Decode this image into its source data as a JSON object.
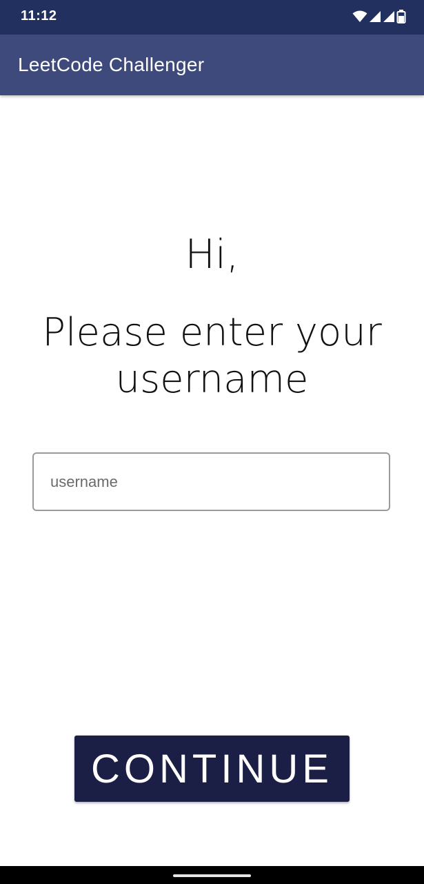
{
  "status_bar": {
    "time": "11:12",
    "icons": [
      "wifi-icon",
      "signal-icon",
      "signal-icon",
      "battery-icon"
    ]
  },
  "app_bar": {
    "title": "LeetCode Challenger"
  },
  "main": {
    "greeting": "Hi,",
    "prompt": "Please enter your username",
    "username_input": {
      "placeholder": "username",
      "value": ""
    },
    "continue_label": "CONTINUE"
  },
  "colors": {
    "status_bar": "#22305f",
    "app_bar": "#3f4a7c",
    "button": "#1b1f45"
  }
}
